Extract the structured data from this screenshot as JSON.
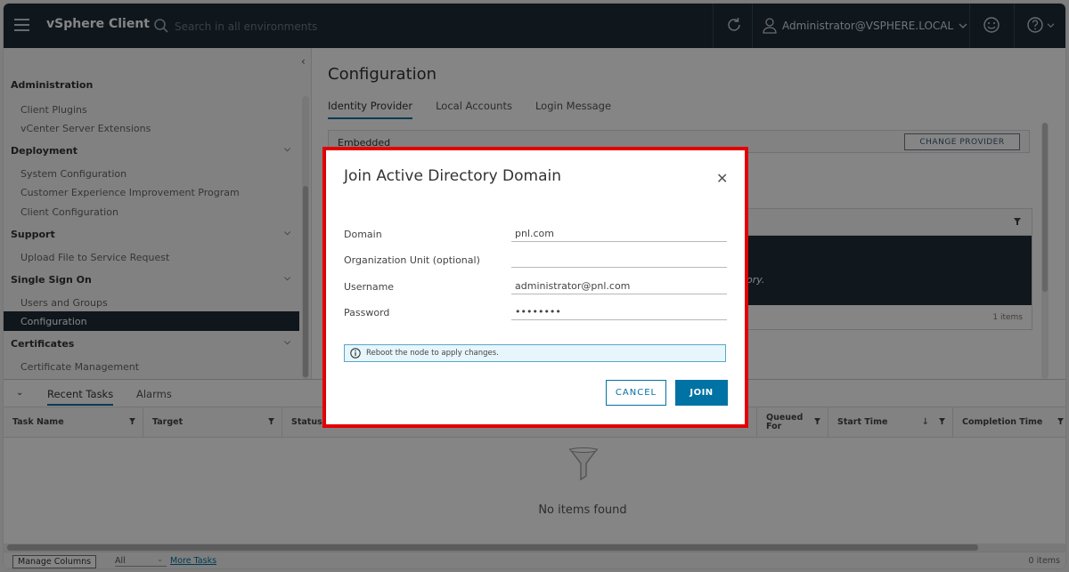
{
  "header": {
    "brand": "vSphere Client",
    "search_placeholder": "Search in all environments",
    "user": "Administrator@VSPHERE.LOCAL"
  },
  "sidebar": {
    "items": [
      {
        "label": "Administration",
        "type": "group"
      },
      {
        "label": "Client Plugins",
        "type": "child"
      },
      {
        "label": "vCenter Server Extensions",
        "type": "child"
      },
      {
        "label": "Deployment",
        "type": "group",
        "expandable": true
      },
      {
        "label": "System Configuration",
        "type": "child"
      },
      {
        "label": "Customer Experience Improvement Program",
        "type": "child"
      },
      {
        "label": "Client Configuration",
        "type": "child"
      },
      {
        "label": "Support",
        "type": "group",
        "expandable": true
      },
      {
        "label": "Upload File to Service Request",
        "type": "child"
      },
      {
        "label": "Single Sign On",
        "type": "group",
        "expandable": true
      },
      {
        "label": "Users and Groups",
        "type": "child"
      },
      {
        "label": "Configuration",
        "type": "child",
        "active": true
      },
      {
        "label": "Certificates",
        "type": "group",
        "expandable": true
      },
      {
        "label": "Certificate Management",
        "type": "child"
      }
    ]
  },
  "main": {
    "title": "Configuration",
    "tabs": [
      "Identity Provider",
      "Local Accounts",
      "Login Message"
    ],
    "active_tab": "Identity Provider",
    "card_label": "Embedded",
    "change_provider": "CHANGE PROVIDER",
    "grid_text_fragment": "ory.",
    "grid_count": "1 items"
  },
  "bottom": {
    "tabs": [
      "Recent Tasks",
      "Alarms"
    ],
    "columns": [
      "Task Name",
      "Target",
      "Status",
      "Queued For",
      "Start Time",
      "Completion Time"
    ],
    "empty": "No items found",
    "manage_columns": "Manage Columns",
    "filter_value": "All",
    "more_tasks": "More Tasks",
    "count": "0 items"
  },
  "modal": {
    "title": "Join Active Directory Domain",
    "fields": [
      {
        "label": "Domain",
        "value": "pnl.com"
      },
      {
        "label": "Organization Unit (optional)",
        "value": ""
      },
      {
        "label": "Username",
        "value": "administrator@pnl.com"
      },
      {
        "label": "Password",
        "value": "••••••••"
      }
    ],
    "info": "Reboot the node to apply changes.",
    "cancel": "CANCEL",
    "join": "JOIN"
  },
  "colors": {
    "header_bg": "#1e2b37",
    "accent": "#0072a3",
    "highlight": "#e30000"
  }
}
